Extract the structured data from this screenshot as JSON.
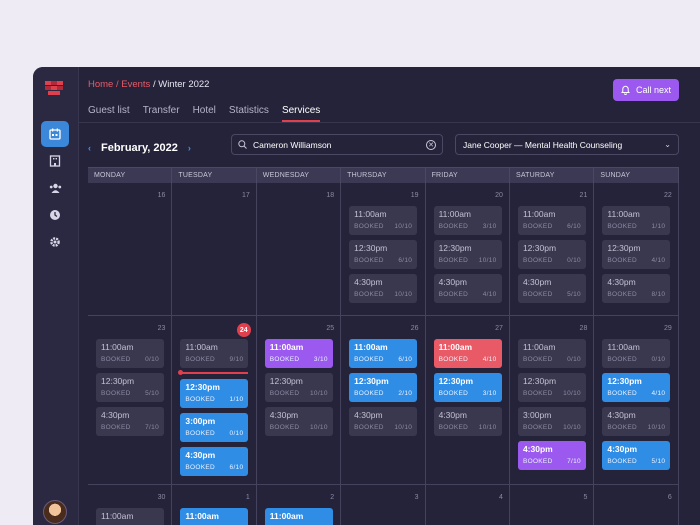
{
  "breadcrumb": {
    "home": "Home",
    "events": "Events",
    "current": "Winter 2022",
    "sep": " / "
  },
  "header": {
    "call_next": "Call next"
  },
  "tabs": [
    "Guest list",
    "Transfer",
    "Hotel",
    "Statistics",
    "Services"
  ],
  "active_tab": "Services",
  "month": {
    "label": "February, 2022",
    "prev": "‹",
    "next": "›"
  },
  "search": {
    "value": "Cameron Williamson"
  },
  "service_select": {
    "value": "Jane Cooper — Mental Health Counseling"
  },
  "weekdays": [
    "MONDAY",
    "TUESDAY",
    "WEDNESDAY",
    "THURSDAY",
    "FRIDAY",
    "SATURDAY",
    "SUNDAY"
  ],
  "booked_label": "BOOKED",
  "colors": {
    "accent_blue": "#2f8de6",
    "accent_purple": "#9b59f0",
    "accent_red": "#e85a66",
    "today": "#e0404e"
  },
  "weeks": [
    [
      {
        "day": "16",
        "slots": []
      },
      {
        "day": "17",
        "slots": []
      },
      {
        "day": "18",
        "slots": []
      },
      {
        "day": "19",
        "slots": [
          {
            "time": "11:00am",
            "count": "10/10"
          },
          {
            "time": "12:30pm",
            "count": "6/10"
          },
          {
            "time": "4:30pm",
            "count": "10/10"
          }
        ]
      },
      {
        "day": "20",
        "slots": [
          {
            "time": "11:00am",
            "count": "3/10"
          },
          {
            "time": "12:30pm",
            "count": "10/10"
          },
          {
            "time": "4:30pm",
            "count": "4/10"
          }
        ]
      },
      {
        "day": "21",
        "slots": [
          {
            "time": "11:00am",
            "count": "6/10"
          },
          {
            "time": "12:30pm",
            "count": "0/10"
          },
          {
            "time": "4:30pm",
            "count": "5/10"
          }
        ]
      },
      {
        "day": "22",
        "slots": [
          {
            "time": "11:00am",
            "count": "1/10"
          },
          {
            "time": "12:30pm",
            "count": "4/10"
          },
          {
            "time": "4:30pm",
            "count": "8/10"
          }
        ]
      }
    ],
    [
      {
        "day": "23",
        "slots": [
          {
            "time": "11:00am",
            "count": "0/10"
          },
          {
            "time": "12:30pm",
            "count": "5/10"
          },
          {
            "time": "4:30pm",
            "count": "7/10"
          }
        ]
      },
      {
        "day": "24",
        "today": true,
        "slots": [
          {
            "time": "11:00am",
            "count": "9/10"
          },
          {
            "now": true
          },
          {
            "time": "12:30pm",
            "count": "1/10",
            "color": "blue"
          },
          {
            "time": "3:00pm",
            "count": "0/10",
            "color": "blue"
          },
          {
            "time": "4:30pm",
            "count": "6/10",
            "color": "blue"
          }
        ]
      },
      {
        "day": "25",
        "slots": [
          {
            "time": "11:00am",
            "count": "3/10",
            "color": "purple"
          },
          {
            "time": "12:30pm",
            "count": "10/10"
          },
          {
            "time": "4:30pm",
            "count": "10/10"
          }
        ]
      },
      {
        "day": "26",
        "slots": [
          {
            "time": "11:00am",
            "count": "6/10",
            "color": "blue"
          },
          {
            "time": "12:30pm",
            "count": "2/10",
            "color": "blue"
          },
          {
            "time": "4:30pm",
            "count": "10/10"
          }
        ]
      },
      {
        "day": "27",
        "slots": [
          {
            "time": "11:00am",
            "count": "4/10",
            "color": "red"
          },
          {
            "time": "12:30pm",
            "count": "3/10",
            "color": "blue"
          },
          {
            "time": "4:30pm",
            "count": "10/10"
          }
        ]
      },
      {
        "day": "28",
        "slots": [
          {
            "time": "11:00am",
            "count": "0/10"
          },
          {
            "time": "12:30pm",
            "count": "10/10"
          },
          {
            "time": "3:00pm",
            "count": "10/10"
          },
          {
            "time": "4:30pm",
            "count": "7/10",
            "color": "purple"
          }
        ]
      },
      {
        "day": "29",
        "slots": [
          {
            "time": "11:00am",
            "count": "0/10"
          },
          {
            "time": "12:30pm",
            "count": "4/10",
            "color": "blue"
          },
          {
            "time": "4:30pm",
            "count": "10/10"
          },
          {
            "time": "4:30pm",
            "count": "5/10",
            "color": "blue"
          }
        ]
      }
    ],
    [
      {
        "day": "30",
        "slots": [
          {
            "time": "11:00am",
            "count": ""
          }
        ]
      },
      {
        "day": "1",
        "slots": [
          {
            "time": "11:00am",
            "count": "",
            "color": "blue"
          }
        ]
      },
      {
        "day": "2",
        "slots": [
          {
            "time": "11:00am",
            "count": "",
            "color": "blue"
          }
        ]
      },
      {
        "day": "3",
        "slots": []
      },
      {
        "day": "4",
        "slots": []
      },
      {
        "day": "5",
        "slots": []
      },
      {
        "day": "6",
        "slots": []
      }
    ]
  ]
}
